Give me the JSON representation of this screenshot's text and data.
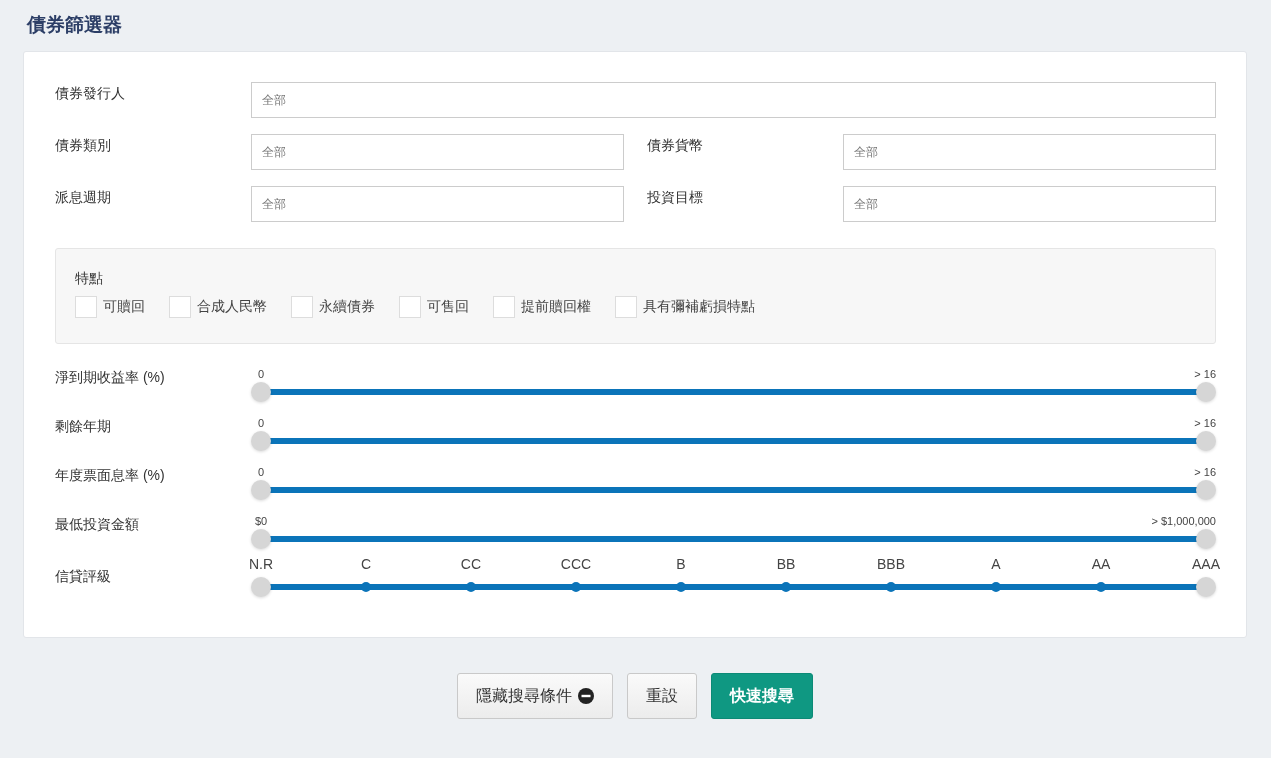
{
  "title": "債券篩選器",
  "field_rows": [
    [
      {
        "label": "債券發行人",
        "placeholder": "全部"
      }
    ],
    [
      {
        "label": "債券類別",
        "placeholder": "全部"
      },
      {
        "label": "債券貨幣",
        "placeholder": "全部"
      }
    ],
    [
      {
        "label": "派息週期",
        "placeholder": "全部"
      },
      {
        "label": "投資目標",
        "placeholder": "全部"
      }
    ]
  ],
  "features": {
    "title": "特點",
    "items": [
      {
        "label": "可贖回",
        "checked": false
      },
      {
        "label": "合成人民幣",
        "checked": false
      },
      {
        "label": "永續債券",
        "checked": false
      },
      {
        "label": "可售回",
        "checked": false
      },
      {
        "label": "提前贖回權",
        "checked": false
      },
      {
        "label": "具有彌補虧損特點",
        "checked": false
      }
    ]
  },
  "sliders": [
    {
      "kind": "range",
      "label": "淨到期收益率 (%)",
      "min": "0",
      "max": "> 16",
      "level": 1
    },
    {
      "kind": "range",
      "label": "剩餘年期",
      "min": "0",
      "max": "> 16",
      "level": 1
    },
    {
      "kind": "range",
      "label": "年度票面息率 (%)",
      "min": "0",
      "max": "> 16",
      "level": 1
    },
    {
      "kind": "range",
      "label": "最低投資金額",
      "min": "$0",
      "max": "> $1,000,000",
      "level": 1
    },
    {
      "kind": "steps",
      "label": "信貸評級",
      "ticks": [
        "N.R",
        "C",
        "CC",
        "CCC",
        "B",
        "BB",
        "BBB",
        "A",
        "AA",
        "AAA"
      ],
      "level": 1
    }
  ],
  "buttons": [
    {
      "kind": "toggle",
      "label": "隱藏搜尋條件"
    },
    {
      "kind": "plain",
      "label": "重設"
    },
    {
      "kind": "primary",
      "label": "快速搜尋"
    }
  ]
}
